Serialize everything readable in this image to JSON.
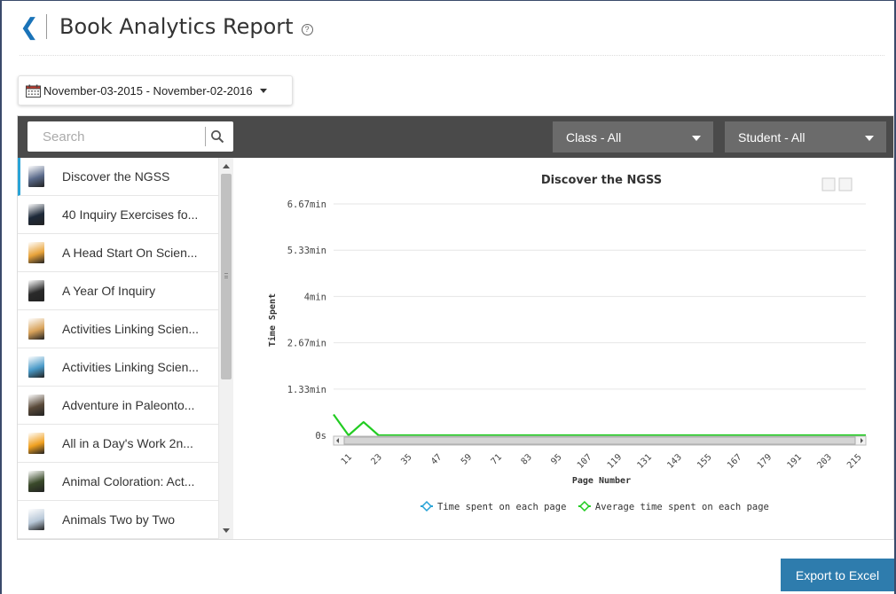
{
  "header": {
    "title": "Book Analytics Report",
    "help_glyph": "?"
  },
  "date_range": {
    "label": "November-03-2015 - November-02-2016"
  },
  "search": {
    "placeholder": "Search"
  },
  "filters": {
    "class_label": "Class - All",
    "student_label": "Student - All"
  },
  "books": [
    {
      "title": "Discover the NGSS",
      "active": true,
      "thumb_color": "#5a6a8a"
    },
    {
      "title": "40 Inquiry Exercises fo...",
      "thumb_color": "#1e2a3a"
    },
    {
      "title": "A Head Start On Scien...",
      "thumb_color": "#e8a33a"
    },
    {
      "title": "A Year Of Inquiry",
      "thumb_color": "#2a2a2a"
    },
    {
      "title": "Activities Linking Scien...",
      "thumb_color": "#d8a25a"
    },
    {
      "title": "Activities Linking Scien...",
      "thumb_color": "#4a9ac8"
    },
    {
      "title": "Adventure in Paleonto...",
      "thumb_color": "#5a4a3a"
    },
    {
      "title": "All in a Day's Work 2n...",
      "thumb_color": "#f0a020"
    },
    {
      "title": "Animal Coloration: Act...",
      "thumb_color": "#3a4a2a"
    },
    {
      "title": "Animals Two by Two",
      "thumb_color": "#b8c8d8"
    }
  ],
  "export": {
    "label": "Export to Excel"
  },
  "chart_data": {
    "type": "line",
    "title": "Discover the NGSS",
    "xlabel": "Page Number",
    "ylabel": "Time Spent",
    "y_ticks": [
      "0s",
      "1.33min",
      "2.67min",
      "4min",
      "5.33min",
      "6.67min"
    ],
    "y_tick_values_min": [
      0,
      1.333,
      2.667,
      4,
      5.333,
      6.667
    ],
    "ylim_min": [
      0,
      6.667
    ],
    "x_ticks": [
      11,
      23,
      35,
      47,
      59,
      71,
      83,
      95,
      107,
      119,
      131,
      143,
      155,
      167,
      179,
      191,
      203,
      215
    ],
    "xlim": [
      5,
      218
    ],
    "legend_position": "bottom",
    "series": [
      {
        "name": "Time spent on each page",
        "color": "#29a3d6",
        "x": [],
        "y": []
      },
      {
        "name": "Average time spent on each page",
        "color": "#22cc22",
        "x": [
          5,
          11,
          17,
          23,
          218
        ],
        "y": [
          0.6,
          0,
          0.38,
          0,
          0
        ]
      }
    ]
  }
}
